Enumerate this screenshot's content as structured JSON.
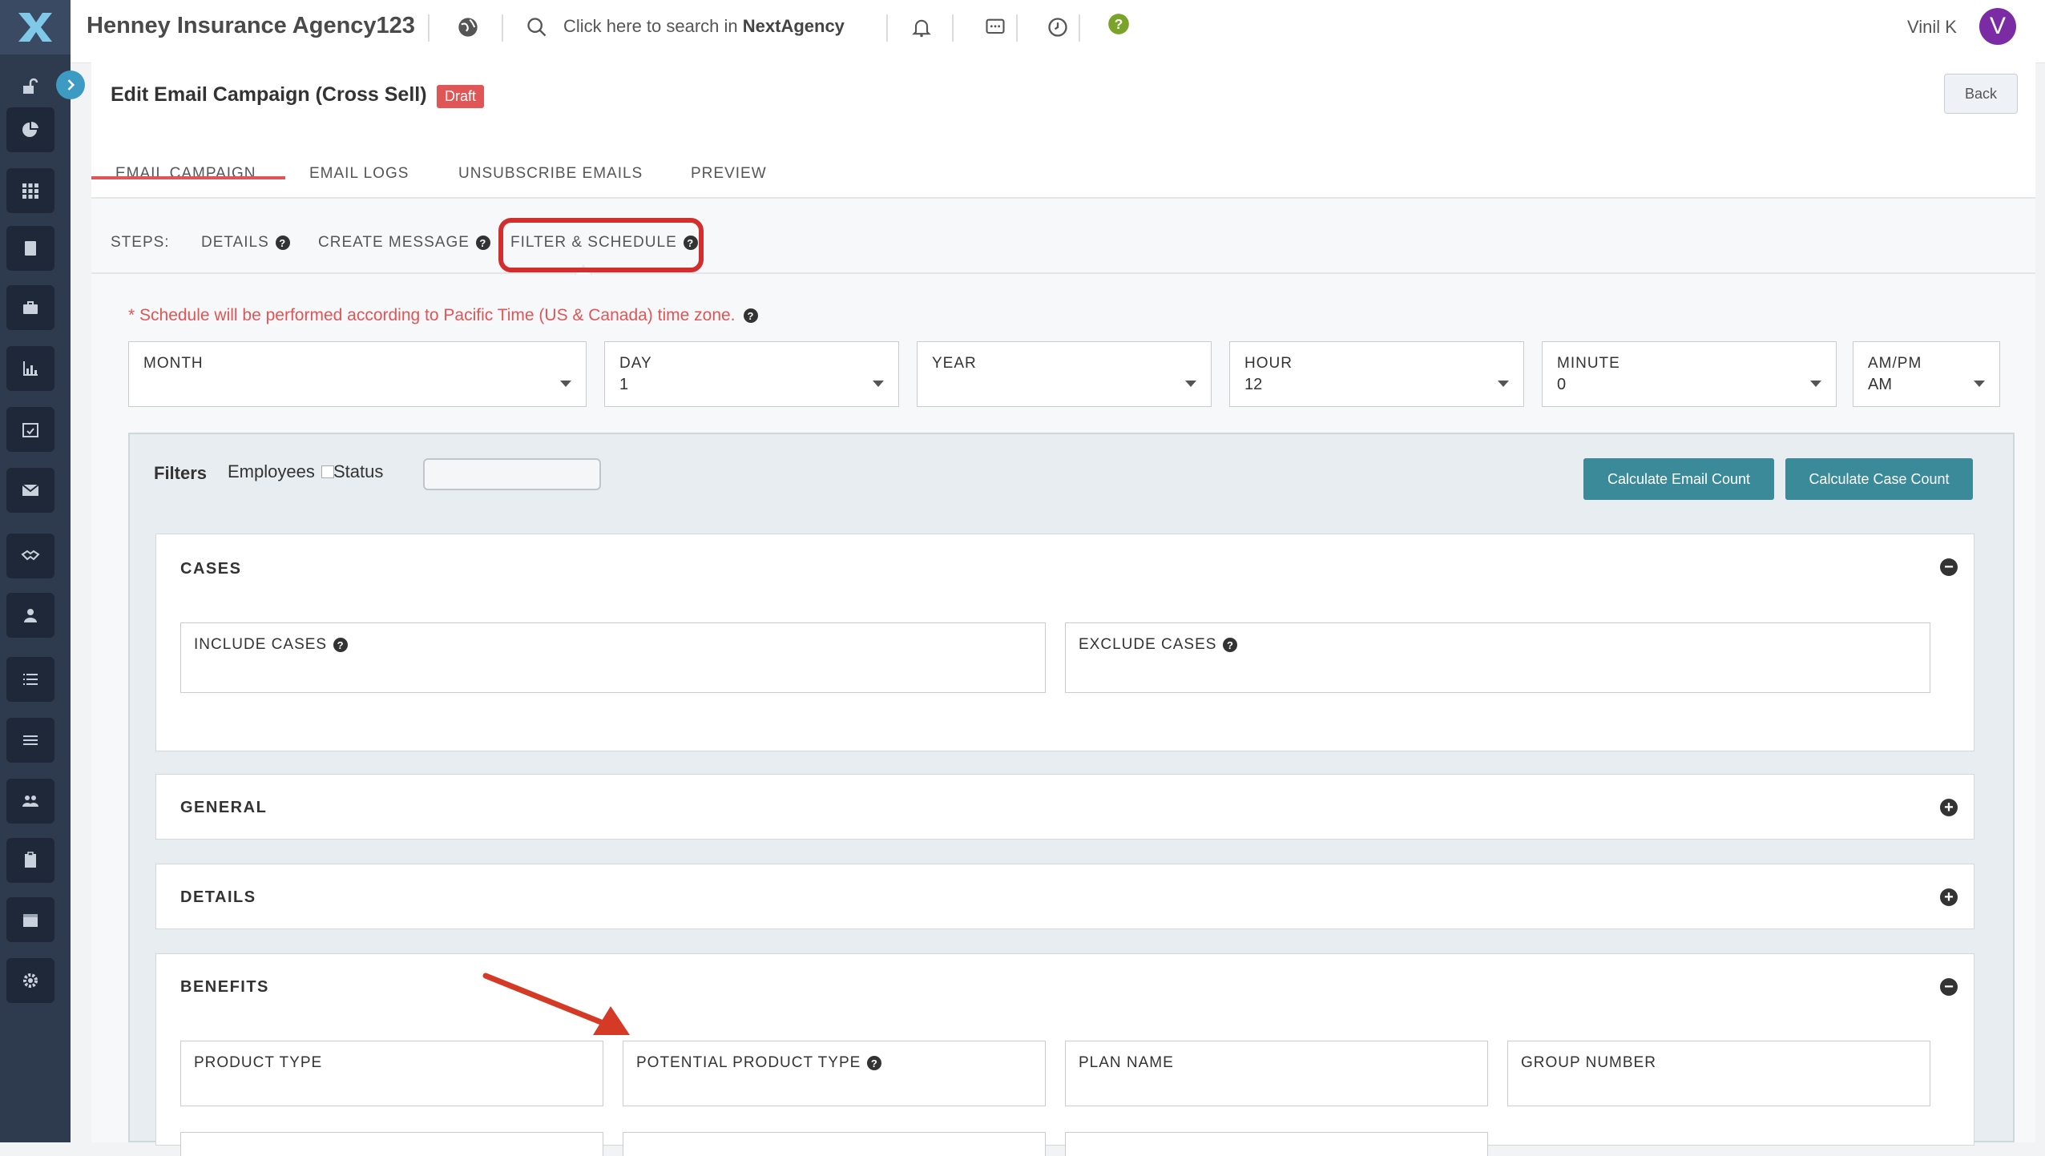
{
  "app": {
    "agency_name": "Henney Insurance Agency123",
    "search_prefix": "Click here to search in ",
    "search_brand": "NextAgency",
    "user_name": "Vinil K",
    "avatar_initial": "V",
    "accent": "#e05555",
    "teal": "#3a8a99"
  },
  "page": {
    "title": "Edit Email Campaign (Cross Sell)",
    "status_badge": "Draft",
    "back_label": "Back"
  },
  "tabs": [
    {
      "label": "EMAIL CAMPAIGN",
      "active": true
    },
    {
      "label": "EMAIL LOGS"
    },
    {
      "label": "UNSUBSCRIBE EMAILS"
    },
    {
      "label": "PREVIEW"
    }
  ],
  "steps": {
    "prefix": "STEPS:",
    "items": [
      {
        "label": "DETAILS"
      },
      {
        "label": "CREATE MESSAGE"
      },
      {
        "label": "FILTER & SCHEDULE",
        "active": true
      }
    ]
  },
  "schedule": {
    "note": "* Schedule will be performed according to Pacific Time (US & Canada) time zone.",
    "fields": [
      {
        "label": "MONTH",
        "value": ""
      },
      {
        "label": "DAY",
        "value": "1"
      },
      {
        "label": "YEAR",
        "value": ""
      },
      {
        "label": "HOUR",
        "value": "12"
      },
      {
        "label": "MINUTE",
        "value": "0"
      },
      {
        "label": "AM/PM",
        "value": "AM"
      }
    ]
  },
  "filters": {
    "label": "Filters",
    "employees_label": "Employees",
    "status_label": "Status",
    "calc_email_label": "Calculate Email Count",
    "calc_case_label": "Calculate Case Count",
    "sections": {
      "cases": {
        "title": "CASES",
        "include": "INCLUDE CASES",
        "exclude": "EXCLUDE CASES"
      },
      "general": {
        "title": "GENERAL"
      },
      "details": {
        "title": "DETAILS"
      },
      "benefits": {
        "title": "BENEFITS",
        "fields": [
          "PRODUCT TYPE",
          "POTENTIAL PRODUCT TYPE",
          "PLAN NAME",
          "GROUP NUMBER"
        ]
      }
    }
  },
  "icons": {
    "sidebar": [
      "unlock-icon",
      "pie-chart-icon",
      "grid-icon",
      "book-icon",
      "briefcase-icon",
      "bar-chart-icon",
      "calendar-check-icon",
      "envelope-icon",
      "handshake-icon",
      "user-icon",
      "list-icon",
      "menu-icon",
      "users-icon",
      "clipboard-icon",
      "calendar-icon",
      "gear-icon"
    ]
  }
}
